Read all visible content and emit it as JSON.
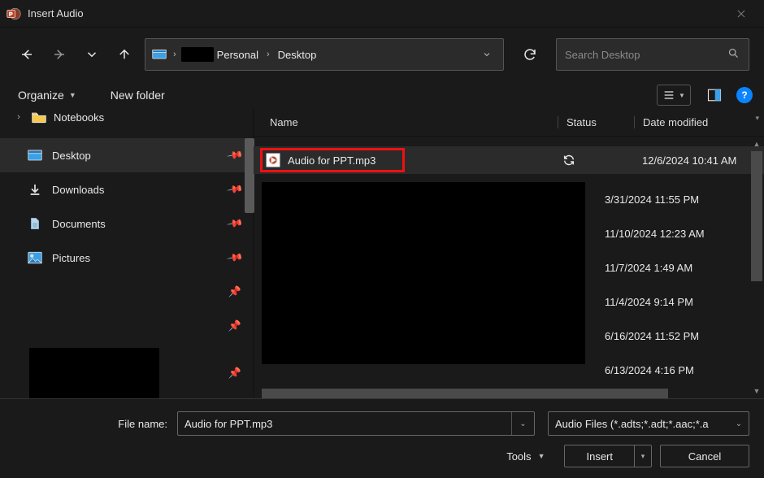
{
  "window": {
    "title": "Insert Audio"
  },
  "breadcrumbs": {
    "b1": "Personal",
    "b2": "Desktop"
  },
  "search": {
    "placeholder": "Search Desktop"
  },
  "toolbar": {
    "organize": "Organize",
    "new_folder": "New folder",
    "help": "?"
  },
  "sidebar": {
    "tree": {
      "notebooks": "Notebooks"
    },
    "items": [
      {
        "label": "Desktop",
        "icon": "desktop"
      },
      {
        "label": "Downloads",
        "icon": "download"
      },
      {
        "label": "Documents",
        "icon": "document"
      },
      {
        "label": "Pictures",
        "icon": "picture"
      }
    ]
  },
  "columns": {
    "name": "Name",
    "status": "Status",
    "date": "Date modified"
  },
  "files": {
    "selected": {
      "name": "Audio for PPT.mp3",
      "date": "12/6/2024 10:41 AM"
    },
    "dates": [
      "3/31/2024 11:55 PM",
      "11/10/2024 12:23 AM",
      "11/7/2024 1:49 AM",
      "11/4/2024 9:14 PM",
      "6/16/2024 11:52 PM",
      "6/13/2024 4:16 PM"
    ]
  },
  "footer": {
    "filename_label": "File name:",
    "filename_value": "Audio for PPT.mp3",
    "filetype": "Audio Files (*.adts;*.adt;*.aac;*.a",
    "tools": "Tools",
    "insert": "Insert",
    "cancel": "Cancel"
  }
}
